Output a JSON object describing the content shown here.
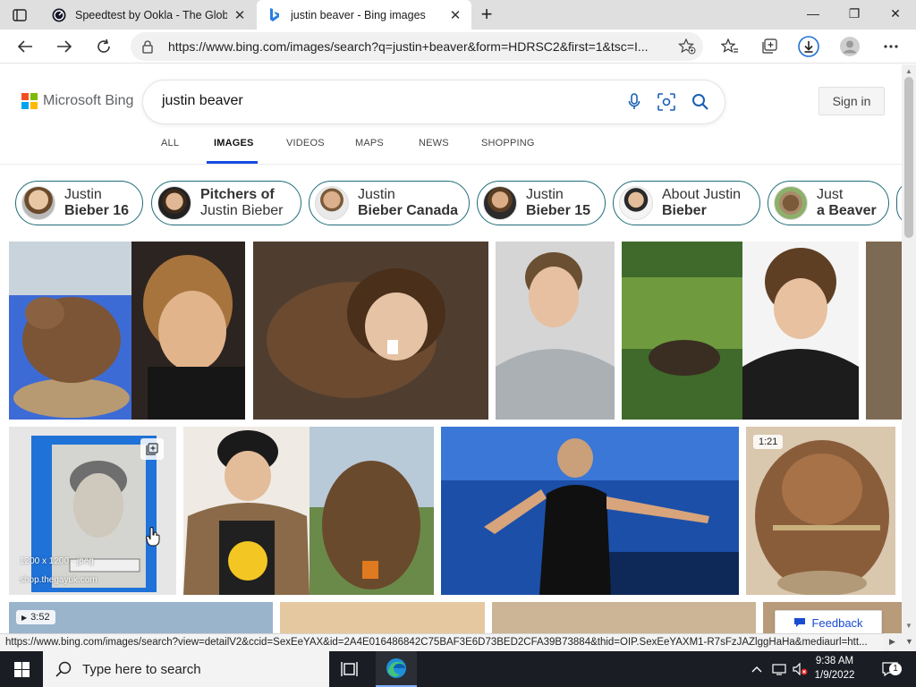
{
  "browser": {
    "tabs": [
      {
        "title": "Speedtest by Ookla - The Global",
        "favicon": "speedtest-icon",
        "active": false
      },
      {
        "title": "justin beaver - Bing images",
        "favicon": "bing-icon",
        "active": true
      }
    ],
    "url": "https://www.bing.com/images/search?q=justin+beaver&form=HDRSC2&first=1&tsc=I..."
  },
  "bing": {
    "logo_text": "Microsoft Bing",
    "search_query": "justin beaver",
    "sign_in_label": "Sign in",
    "scopes": [
      "ALL",
      "IMAGES",
      "VIDEOS",
      "MAPS",
      "NEWS",
      "SHOPPING"
    ],
    "active_scope": "IMAGES",
    "related": [
      {
        "line1": "Justin",
        "line2": "Bieber 16",
        "bold": "line2"
      },
      {
        "line1": "Pitchers of",
        "line2": "Justin Bieber",
        "bold": "line1"
      },
      {
        "line1": "Justin",
        "line2": "Bieber Canada",
        "bold": "line2"
      },
      {
        "line1": "Justin",
        "line2": "Bieber 15",
        "bold": "line2"
      },
      {
        "line1": "About Justin",
        "line2": "Bieber",
        "bold": "line2"
      },
      {
        "line1": "Just",
        "line2": "a Beaver",
        "bold": "line2"
      }
    ],
    "tile_overlays": {
      "hover_dims": "1200 x 1200 · jpeg",
      "hover_source": "shop.thegayuk.com",
      "video_duration_1": "1:21",
      "video_duration_2": "3:52"
    },
    "feedback_label": "Feedback"
  },
  "status_url": "https://www.bing.com/images/search?view=detailV2&ccid=SexEeYAX&id=2A4E016486842C75BAF3E6D73BED2CFA39B73884&thid=OIP.SexEeYAXM1-R7sFzJAZlggHaHa&mediaurl=htt...",
  "taskbar": {
    "search_placeholder": "Type here to search",
    "time": "9:38 AM",
    "date": "1/9/2022",
    "notification_count": "1"
  },
  "colors": {
    "accent": "#174ae4",
    "chip_border": "#1f6c7a",
    "taskbar": "#1a1d24"
  }
}
